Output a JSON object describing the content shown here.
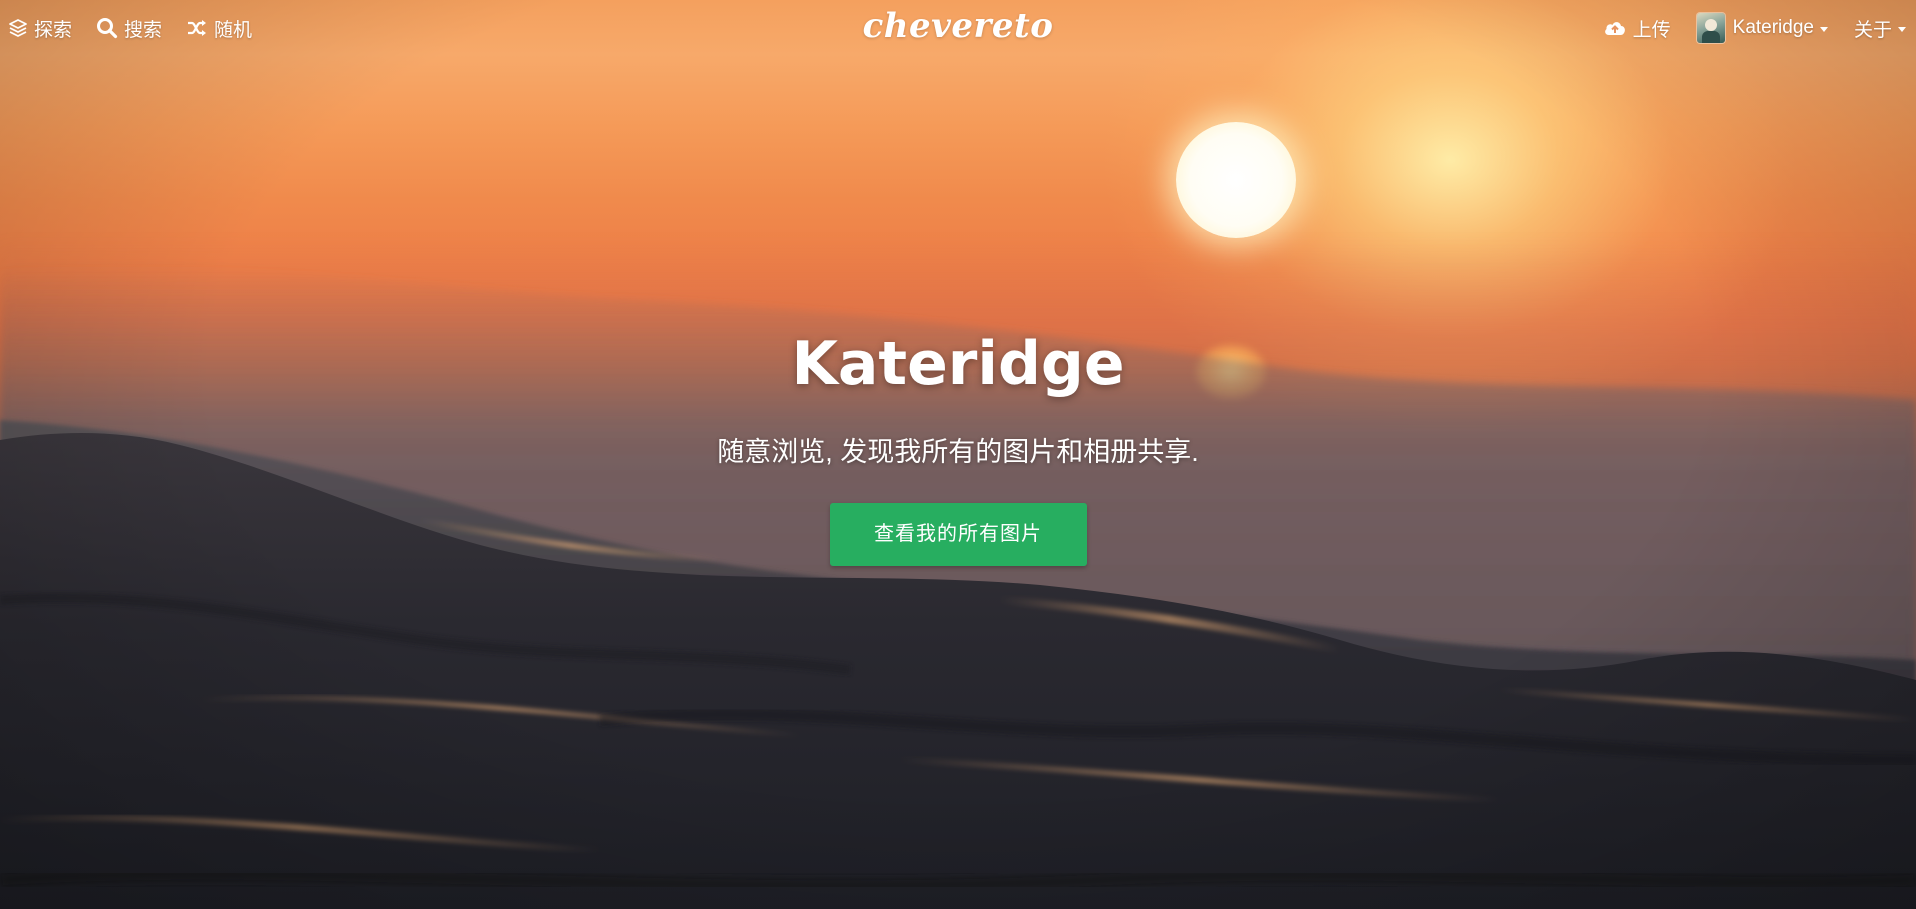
{
  "topbar": {
    "left_nav": [
      {
        "label": "探索",
        "icon": "layers-icon"
      },
      {
        "label": "搜索",
        "icon": "search-icon"
      },
      {
        "label": "随机",
        "icon": "shuffle-icon"
      }
    ],
    "logo_text": "chevereto",
    "right_nav": {
      "upload_label": "上传",
      "upload_icon": "cloud-upload-icon",
      "user_name": "Kateridge",
      "about_label": "关于"
    }
  },
  "hero": {
    "title": "Kateridge",
    "subtitle": "随意浏览, 发现我所有的图片和相册共享.",
    "cta_label": "查看我的所有图片"
  },
  "colors": {
    "cta_bg": "#27ae60",
    "text": "#ffffff"
  }
}
